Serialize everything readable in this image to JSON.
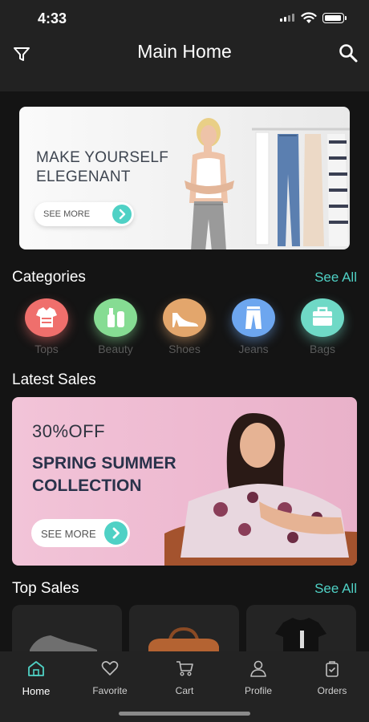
{
  "status": {
    "time": "4:33"
  },
  "header": {
    "title": "Main Home",
    "filter_icon": "filter-icon",
    "search_icon": "search-icon"
  },
  "hero": {
    "headline": "MAKE YOURSELF ELEGENANT",
    "button_label": "SEE MORE",
    "button_color": "#4fd1c5"
  },
  "categories": {
    "title": "Categories",
    "see_all": "See All",
    "items": [
      {
        "label": "Tops",
        "icon": "shirt-icon",
        "color": "#ef6f6c"
      },
      {
        "label": "Beauty",
        "icon": "cosmetics-icon",
        "color": "#86dc93"
      },
      {
        "label": "Shoes",
        "icon": "heel-shoe-icon",
        "color": "#e3a66c"
      },
      {
        "label": "Jeans",
        "icon": "jeans-icon",
        "color": "#6da6ef"
      },
      {
        "label": "Bags",
        "icon": "bag-icon",
        "color": "#6fd9c6"
      }
    ]
  },
  "latest_sales": {
    "title": "Latest Sales",
    "discount": "30%OFF",
    "collection": "SPRING SUMMER COLLECTION",
    "button_label": "SEE MORE"
  },
  "top_sales": {
    "title": "Top Sales",
    "see_all": "See All",
    "items": [
      {
        "icon": "sneaker-icon"
      },
      {
        "icon": "handbag-icon"
      },
      {
        "icon": "tshirt-icon"
      }
    ]
  },
  "tabbar": {
    "items": [
      {
        "label": "Home",
        "icon": "home-icon",
        "active": true
      },
      {
        "label": "Favorite",
        "icon": "heart-icon",
        "active": false
      },
      {
        "label": "Cart",
        "icon": "cart-icon",
        "active": false
      },
      {
        "label": "Profile",
        "icon": "user-icon",
        "active": false
      },
      {
        "label": "Orders",
        "icon": "orders-icon",
        "active": false
      }
    ]
  },
  "colors": {
    "accent": "#4fd1c5",
    "background": "#141414",
    "bar": "#222222"
  }
}
